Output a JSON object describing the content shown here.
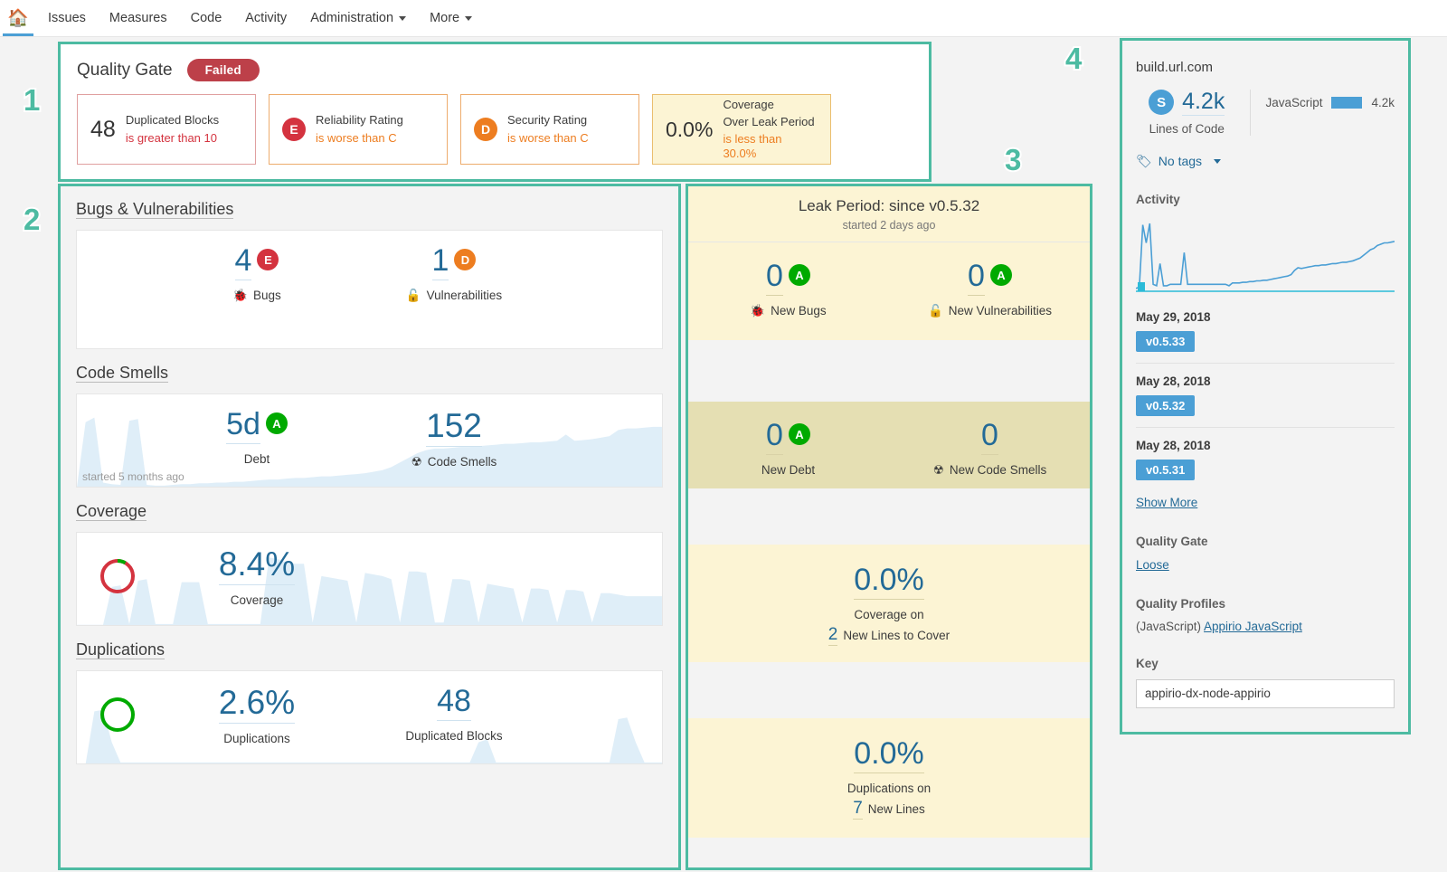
{
  "nav": {
    "home_icon": "home-icon",
    "items": [
      {
        "label": "Issues",
        "caret": false
      },
      {
        "label": "Measures",
        "caret": false
      },
      {
        "label": "Code",
        "caret": false
      },
      {
        "label": "Activity",
        "caret": false
      },
      {
        "label": "Administration",
        "caret": true
      },
      {
        "label": "More",
        "caret": true
      }
    ]
  },
  "quality_gate": {
    "title": "Quality Gate",
    "status": "Failed",
    "status_color": "#bd4049",
    "conditions": [
      {
        "value": "48",
        "name": "Duplicated Blocks",
        "rule": "is greater than 10",
        "rating": null,
        "style": "red"
      },
      {
        "value": null,
        "name": "Reliability Rating",
        "rule": "is worse than C",
        "rating": "E",
        "style": "orange"
      },
      {
        "value": null,
        "name": "Security Rating",
        "rule": "is worse than C",
        "rating": "D",
        "style": "orange"
      },
      {
        "value": "0.0%",
        "name": "Coverage",
        "name2": "Over Leak Period",
        "rule": "is less than 30.0%",
        "rating": null,
        "style": "leak"
      }
    ]
  },
  "measures": {
    "sections": [
      {
        "heading": "Bugs & Vulnerabilities",
        "started": null,
        "items": [
          {
            "value": "4",
            "label": "Bugs",
            "icon": "bug-icon",
            "rating": "E"
          },
          {
            "value": "1",
            "label": "Vulnerabilities",
            "icon": "lock-icon",
            "rating": "D"
          }
        ]
      },
      {
        "heading": "Code Smells",
        "started": "started 5 months ago",
        "items": [
          {
            "value": "5d",
            "label": "Debt",
            "icon": null,
            "rating": "A"
          },
          {
            "value": "152",
            "label": "Code Smells",
            "icon": "code-smell-icon",
            "rating": null
          }
        ]
      },
      {
        "heading": "Coverage",
        "started": null,
        "donut": {
          "percent": 8.4,
          "ring_color": "#d4333f",
          "fill_color": "#00aa00"
        },
        "items": [
          {
            "value": "8.4%",
            "label": "Coverage",
            "icon": null,
            "rating": null
          }
        ]
      },
      {
        "heading": "Duplications",
        "started": null,
        "donut": {
          "percent": 2.6,
          "ring_color": "#00aa00",
          "fill_color": "#00aa00"
        },
        "items": [
          {
            "value": "2.6%",
            "label": "Duplications",
            "icon": null,
            "rating": null
          },
          {
            "value": "48",
            "label": "Duplicated Blocks",
            "icon": null,
            "rating": null
          }
        ]
      }
    ]
  },
  "leak": {
    "title": "Leak Period: since v0.5.32",
    "subtitle": "started 2 days ago",
    "blocks": [
      {
        "shade": "light",
        "items": [
          {
            "value": "0",
            "label": "New Bugs",
            "icon": "bug-icon",
            "rating": "A"
          },
          {
            "value": "0",
            "label": "New Vulnerabilities",
            "icon": "lock-icon",
            "rating": "A"
          }
        ]
      },
      {
        "shade": "dark",
        "items": [
          {
            "value": "0",
            "label": "New Debt",
            "icon": null,
            "rating": "A"
          },
          {
            "value": "0",
            "label": "New Code Smells",
            "icon": "code-smell-icon",
            "rating": null
          }
        ]
      },
      {
        "shade": "light",
        "center": {
          "value": "0.0%",
          "line1": "Coverage on",
          "count": "2",
          "line2": "New Lines to Cover"
        }
      },
      {
        "shade": "light",
        "center": {
          "value": "0.0%",
          "line1": "Duplications on",
          "count": "7",
          "line2": "New Lines"
        }
      }
    ]
  },
  "sidebar": {
    "project_name": "build.url.com",
    "size_badge": "S",
    "lines_value": "4.2k",
    "lines_caption": "Lines of Code",
    "languages": [
      {
        "name": "JavaScript",
        "value": "4.2k"
      }
    ],
    "tags_label": "No tags",
    "tags_icon": "tag-icon",
    "activity_heading": "Activity",
    "events": [
      {
        "date": "May 29, 2018",
        "version": "v0.5.33"
      },
      {
        "date": "May 28, 2018",
        "version": "v0.5.32"
      },
      {
        "date": "May 28, 2018",
        "version": "v0.5.31"
      }
    ],
    "show_more": "Show More",
    "quality_gate_heading": "Quality Gate",
    "quality_gate_value": "Loose",
    "quality_profiles_heading": "Quality Profiles",
    "quality_profile_lang": "(JavaScript)",
    "quality_profile_name": "Appirio JavaScript",
    "key_heading": "Key",
    "key_value": "appirio-dx-node-appirio"
  },
  "annotations": {
    "accent_color": "#4dbba2",
    "markers": [
      "1",
      "2",
      "3",
      "4"
    ]
  },
  "chart_data": [
    {
      "type": "area",
      "name": "code-smells-sparkline",
      "ylabel": "Code Smells",
      "values": [
        2,
        86,
        92,
        8,
        6,
        5,
        88,
        90,
        5,
        4,
        4,
        5,
        6,
        6,
        7,
        7,
        8,
        8,
        9,
        9,
        10,
        11,
        12,
        12,
        13,
        14,
        14,
        15,
        16,
        16,
        17,
        18,
        19,
        20,
        22,
        24,
        28,
        34,
        40,
        46,
        50,
        52,
        52,
        53,
        54,
        54,
        55,
        56,
        57,
        58,
        58,
        59,
        60,
        60,
        61,
        62,
        70,
        62,
        63,
        64,
        66,
        68,
        76,
        78,
        78,
        79,
        80,
        80
      ],
      "ylim": [
        0,
        100
      ],
      "grid": false
    },
    {
      "type": "area",
      "name": "coverage-sparkline",
      "ylabel": "Coverage %",
      "values": [
        3,
        3,
        3,
        3,
        52,
        54,
        4,
        60,
        62,
        4,
        4,
        4,
        58,
        58,
        58,
        4,
        4,
        4,
        4,
        4,
        4,
        4,
        90,
        88,
        84,
        82,
        82,
        6,
        66,
        64,
        62,
        60,
        6,
        70,
        68,
        66,
        62,
        6,
        72,
        72,
        70,
        6,
        6,
        62,
        62,
        60,
        6,
        56,
        54,
        52,
        50,
        6,
        50,
        50,
        48,
        6,
        48,
        48,
        46,
        6,
        44,
        44,
        42,
        40,
        40,
        40,
        40,
        40
      ],
      "ylim": [
        0,
        100
      ],
      "grid": false
    },
    {
      "type": "area",
      "name": "duplications-sparkline",
      "ylabel": "Duplications %",
      "values": [
        2,
        2,
        70,
        72,
        30,
        4,
        4,
        4,
        4,
        4,
        4,
        4,
        4,
        4,
        4,
        4,
        4,
        4,
        4,
        4,
        4,
        4,
        4,
        4,
        4,
        4,
        4,
        4,
        4,
        4,
        4,
        4,
        4,
        4,
        4,
        4,
        4,
        4,
        4,
        4,
        4,
        4,
        4,
        4,
        4,
        4,
        30,
        34,
        4,
        4,
        4,
        4,
        4,
        4,
        4,
        4,
        4,
        4,
        4,
        4,
        4,
        4,
        60,
        62,
        30,
        4,
        4,
        4
      ],
      "ylim": [
        0,
        100
      ],
      "grid": false
    },
    {
      "type": "line",
      "name": "activity-history-chart",
      "ylabel": "Lines of Code",
      "values": [
        4,
        6,
        96,
        70,
        98,
        10,
        8,
        40,
        8,
        8,
        10,
        10,
        10,
        10,
        56,
        10,
        10,
        10,
        10,
        10,
        10,
        10,
        10,
        10,
        10,
        10,
        10,
        8,
        12,
        12,
        12,
        13,
        13,
        14,
        14,
        15,
        15,
        16,
        16,
        17,
        18,
        19,
        20,
        21,
        22,
        24,
        30,
        34,
        33,
        34,
        35,
        36,
        37,
        37,
        38,
        38,
        39,
        40,
        40,
        41,
        42,
        42,
        43,
        44,
        46,
        48,
        52,
        56,
        60,
        62,
        66,
        68,
        70,
        70,
        71,
        72
      ],
      "ylim": [
        0,
        100
      ],
      "grid": false
    }
  ]
}
